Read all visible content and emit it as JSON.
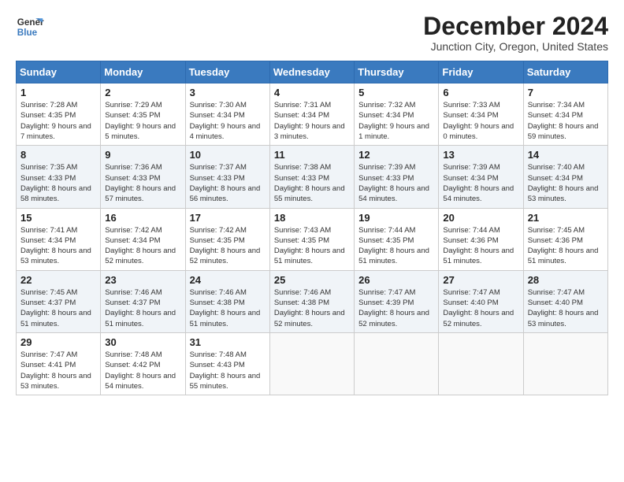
{
  "header": {
    "logo_line1": "General",
    "logo_line2": "Blue",
    "month": "December 2024",
    "location": "Junction City, Oregon, United States"
  },
  "weekdays": [
    "Sunday",
    "Monday",
    "Tuesday",
    "Wednesday",
    "Thursday",
    "Friday",
    "Saturday"
  ],
  "weeks": [
    [
      {
        "day": 1,
        "sunrise": "Sunrise: 7:28 AM",
        "sunset": "Sunset: 4:35 PM",
        "daylight": "Daylight: 9 hours and 7 minutes."
      },
      {
        "day": 2,
        "sunrise": "Sunrise: 7:29 AM",
        "sunset": "Sunset: 4:35 PM",
        "daylight": "Daylight: 9 hours and 5 minutes."
      },
      {
        "day": 3,
        "sunrise": "Sunrise: 7:30 AM",
        "sunset": "Sunset: 4:34 PM",
        "daylight": "Daylight: 9 hours and 4 minutes."
      },
      {
        "day": 4,
        "sunrise": "Sunrise: 7:31 AM",
        "sunset": "Sunset: 4:34 PM",
        "daylight": "Daylight: 9 hours and 3 minutes."
      },
      {
        "day": 5,
        "sunrise": "Sunrise: 7:32 AM",
        "sunset": "Sunset: 4:34 PM",
        "daylight": "Daylight: 9 hours and 1 minute."
      },
      {
        "day": 6,
        "sunrise": "Sunrise: 7:33 AM",
        "sunset": "Sunset: 4:34 PM",
        "daylight": "Daylight: 9 hours and 0 minutes."
      },
      {
        "day": 7,
        "sunrise": "Sunrise: 7:34 AM",
        "sunset": "Sunset: 4:34 PM",
        "daylight": "Daylight: 8 hours and 59 minutes."
      }
    ],
    [
      {
        "day": 8,
        "sunrise": "Sunrise: 7:35 AM",
        "sunset": "Sunset: 4:33 PM",
        "daylight": "Daylight: 8 hours and 58 minutes."
      },
      {
        "day": 9,
        "sunrise": "Sunrise: 7:36 AM",
        "sunset": "Sunset: 4:33 PM",
        "daylight": "Daylight: 8 hours and 57 minutes."
      },
      {
        "day": 10,
        "sunrise": "Sunrise: 7:37 AM",
        "sunset": "Sunset: 4:33 PM",
        "daylight": "Daylight: 8 hours and 56 minutes."
      },
      {
        "day": 11,
        "sunrise": "Sunrise: 7:38 AM",
        "sunset": "Sunset: 4:33 PM",
        "daylight": "Daylight: 8 hours and 55 minutes."
      },
      {
        "day": 12,
        "sunrise": "Sunrise: 7:39 AM",
        "sunset": "Sunset: 4:33 PM",
        "daylight": "Daylight: 8 hours and 54 minutes."
      },
      {
        "day": 13,
        "sunrise": "Sunrise: 7:39 AM",
        "sunset": "Sunset: 4:34 PM",
        "daylight": "Daylight: 8 hours and 54 minutes."
      },
      {
        "day": 14,
        "sunrise": "Sunrise: 7:40 AM",
        "sunset": "Sunset: 4:34 PM",
        "daylight": "Daylight: 8 hours and 53 minutes."
      }
    ],
    [
      {
        "day": 15,
        "sunrise": "Sunrise: 7:41 AM",
        "sunset": "Sunset: 4:34 PM",
        "daylight": "Daylight: 8 hours and 53 minutes."
      },
      {
        "day": 16,
        "sunrise": "Sunrise: 7:42 AM",
        "sunset": "Sunset: 4:34 PM",
        "daylight": "Daylight: 8 hours and 52 minutes."
      },
      {
        "day": 17,
        "sunrise": "Sunrise: 7:42 AM",
        "sunset": "Sunset: 4:35 PM",
        "daylight": "Daylight: 8 hours and 52 minutes."
      },
      {
        "day": 18,
        "sunrise": "Sunrise: 7:43 AM",
        "sunset": "Sunset: 4:35 PM",
        "daylight": "Daylight: 8 hours and 51 minutes."
      },
      {
        "day": 19,
        "sunrise": "Sunrise: 7:44 AM",
        "sunset": "Sunset: 4:35 PM",
        "daylight": "Daylight: 8 hours and 51 minutes."
      },
      {
        "day": 20,
        "sunrise": "Sunrise: 7:44 AM",
        "sunset": "Sunset: 4:36 PM",
        "daylight": "Daylight: 8 hours and 51 minutes."
      },
      {
        "day": 21,
        "sunrise": "Sunrise: 7:45 AM",
        "sunset": "Sunset: 4:36 PM",
        "daylight": "Daylight: 8 hours and 51 minutes."
      }
    ],
    [
      {
        "day": 22,
        "sunrise": "Sunrise: 7:45 AM",
        "sunset": "Sunset: 4:37 PM",
        "daylight": "Daylight: 8 hours and 51 minutes."
      },
      {
        "day": 23,
        "sunrise": "Sunrise: 7:46 AM",
        "sunset": "Sunset: 4:37 PM",
        "daylight": "Daylight: 8 hours and 51 minutes."
      },
      {
        "day": 24,
        "sunrise": "Sunrise: 7:46 AM",
        "sunset": "Sunset: 4:38 PM",
        "daylight": "Daylight: 8 hours and 51 minutes."
      },
      {
        "day": 25,
        "sunrise": "Sunrise: 7:46 AM",
        "sunset": "Sunset: 4:38 PM",
        "daylight": "Daylight: 8 hours and 52 minutes."
      },
      {
        "day": 26,
        "sunrise": "Sunrise: 7:47 AM",
        "sunset": "Sunset: 4:39 PM",
        "daylight": "Daylight: 8 hours and 52 minutes."
      },
      {
        "day": 27,
        "sunrise": "Sunrise: 7:47 AM",
        "sunset": "Sunset: 4:40 PM",
        "daylight": "Daylight: 8 hours and 52 minutes."
      },
      {
        "day": 28,
        "sunrise": "Sunrise: 7:47 AM",
        "sunset": "Sunset: 4:40 PM",
        "daylight": "Daylight: 8 hours and 53 minutes."
      }
    ],
    [
      {
        "day": 29,
        "sunrise": "Sunrise: 7:47 AM",
        "sunset": "Sunset: 4:41 PM",
        "daylight": "Daylight: 8 hours and 53 minutes."
      },
      {
        "day": 30,
        "sunrise": "Sunrise: 7:48 AM",
        "sunset": "Sunset: 4:42 PM",
        "daylight": "Daylight: 8 hours and 54 minutes."
      },
      {
        "day": 31,
        "sunrise": "Sunrise: 7:48 AM",
        "sunset": "Sunset: 4:43 PM",
        "daylight": "Daylight: 8 hours and 55 minutes."
      },
      null,
      null,
      null,
      null
    ]
  ]
}
